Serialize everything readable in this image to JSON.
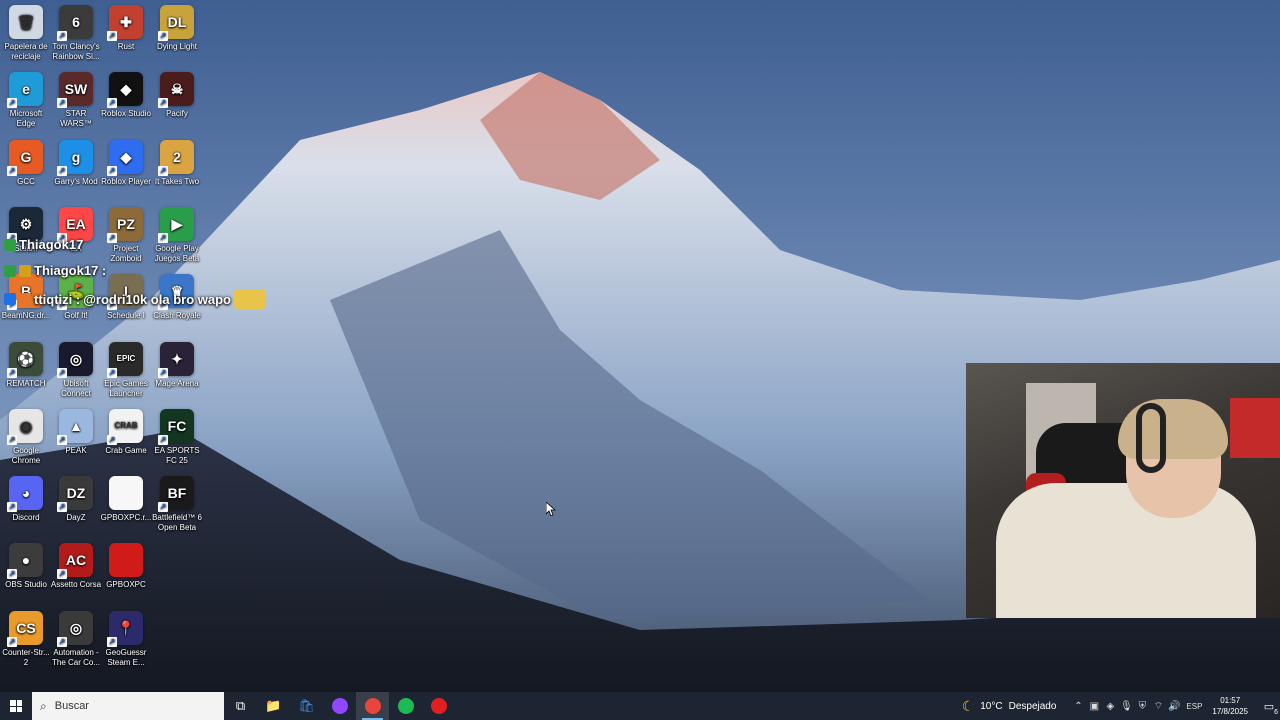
{
  "desktop": {
    "icons": [
      {
        "label": "Papelera de reciclaje",
        "icon": "recycle-bin-icon",
        "color": "#cfd8e3",
        "glyph": "🗑",
        "shortcut": false
      },
      {
        "label": "Tom Clancy's Rainbow Si...",
        "icon": "rainbow-six-icon",
        "color": "#3b3b3b",
        "glyph": "6",
        "shortcut": true
      },
      {
        "label": "Rust",
        "icon": "rust-icon",
        "color": "#c2402f",
        "glyph": "✚",
        "shortcut": true
      },
      {
        "label": "Dying Light",
        "icon": "dying-light-icon",
        "color": "#c8a23a",
        "glyph": "DL",
        "shortcut": true
      },
      {
        "label": "Microsoft Edge",
        "icon": "edge-icon",
        "color": "#1f9bd8",
        "glyph": "e",
        "shortcut": true
      },
      {
        "label": "STAR WARS™ Battlefront...",
        "icon": "star-wars-battlefront-icon",
        "color": "#5a2a2a",
        "glyph": "SW",
        "shortcut": true
      },
      {
        "label": "Roblox Studio",
        "icon": "roblox-studio-icon",
        "color": "#111111",
        "glyph": "◆",
        "shortcut": true
      },
      {
        "label": "Pacify",
        "icon": "pacify-icon",
        "color": "#4a1c1c",
        "glyph": "☠",
        "shortcut": true
      },
      {
        "label": "GCC",
        "icon": "gcc-icon",
        "color": "#e85a23",
        "glyph": "G",
        "shortcut": true
      },
      {
        "label": "Garry's Mod",
        "icon": "garrys-mod-icon",
        "color": "#1e8fe6",
        "glyph": "g",
        "shortcut": true
      },
      {
        "label": "Roblox Player",
        "icon": "roblox-player-icon",
        "color": "#2e6cf0",
        "glyph": "◆",
        "shortcut": true
      },
      {
        "label": "It Takes Two",
        "icon": "it-takes-two-icon",
        "color": "#d9a441",
        "glyph": "2",
        "shortcut": true
      },
      {
        "label": "Steam",
        "icon": "steam-icon",
        "color": "#1b2838",
        "glyph": "⚙",
        "shortcut": true
      },
      {
        "label": "EA",
        "icon": "ea-icon",
        "color": "#ff4747",
        "glyph": "EA",
        "shortcut": true
      },
      {
        "label": "Project Zomboid",
        "icon": "project-zomboid-icon",
        "color": "#8c6a3a",
        "glyph": "PZ",
        "shortcut": true
      },
      {
        "label": "Google Play Juegos Beta",
        "icon": "google-play-games-icon",
        "color": "#2a9d4a",
        "glyph": "▶",
        "shortcut": true
      },
      {
        "label": "BeamNG.dr...",
        "icon": "beamng-icon",
        "color": "#e8742a",
        "glyph": "B",
        "shortcut": true
      },
      {
        "label": "Golf It!",
        "icon": "golf-it-icon",
        "color": "#5db04a",
        "glyph": "⛳",
        "shortcut": true
      },
      {
        "label": "Schedule I",
        "icon": "schedule-one-icon",
        "color": "#7a6e52",
        "glyph": "I",
        "shortcut": true
      },
      {
        "label": "Clash Royale",
        "icon": "clash-royale-icon",
        "color": "#3b76c9",
        "glyph": "♛",
        "shortcut": true
      },
      {
        "label": "REMATCH",
        "icon": "rematch-icon",
        "color": "#3c4c3a",
        "glyph": "⚽",
        "shortcut": true
      },
      {
        "label": "Ubisoft Connect",
        "icon": "ubisoft-connect-icon",
        "color": "#1a1a2e",
        "glyph": "◎",
        "shortcut": true
      },
      {
        "label": "Epic Games Launcher",
        "icon": "epic-games-icon",
        "color": "#2a2a2a",
        "glyph": "EPIC",
        "shortcut": true
      },
      {
        "label": "Mage Arena",
        "icon": "mage-arena-icon",
        "color": "#2a2236",
        "glyph": "✦",
        "shortcut": true
      },
      {
        "label": "Google Chrome",
        "icon": "chrome-icon",
        "color": "#e6e6e6",
        "glyph": "◉",
        "shortcut": true
      },
      {
        "label": "PEAK",
        "icon": "peak-icon",
        "color": "#9ab7df",
        "glyph": "▲",
        "shortcut": true
      },
      {
        "label": "Crab Game",
        "icon": "crab-game-icon",
        "color": "#f2f2f2",
        "glyph": "CRAB",
        "shortcut": true
      },
      {
        "label": "EA SPORTS FC 25",
        "icon": "ea-sports-fc-icon",
        "color": "#12361f",
        "glyph": "FC",
        "shortcut": true
      },
      {
        "label": "Discord",
        "icon": "discord-icon",
        "color": "#5865f2",
        "glyph": "◕",
        "shortcut": true
      },
      {
        "label": "DayZ",
        "icon": "dayz-icon",
        "color": "#3a3a3a",
        "glyph": "DZ",
        "shortcut": true
      },
      {
        "label": "GPBOXPC.r...",
        "icon": "file-icon",
        "color": "#f7f7f7",
        "glyph": "",
        "shortcut": false
      },
      {
        "label": "Battlefield™ 6 Open Beta",
        "icon": "battlefield-icon",
        "color": "#1a1a1a",
        "glyph": "BF",
        "shortcut": true
      },
      {
        "label": "OBS Studio",
        "icon": "obs-icon",
        "color": "#3c3c3c",
        "glyph": "●",
        "shortcut": true
      },
      {
        "label": "Assetto Corsa",
        "icon": "assetto-corsa-icon",
        "color": "#b31b1b",
        "glyph": "AC",
        "shortcut": true
      },
      {
        "label": "GPBOXPC",
        "icon": "folder-icon",
        "color": "#d11a1a",
        "glyph": "",
        "shortcut": false
      },
      {
        "label": "",
        "icon": "empty",
        "color": "",
        "glyph": "",
        "shortcut": false
      },
      {
        "label": "Counter-Str... 2",
        "icon": "counter-strike-icon",
        "color": "#e89a2a",
        "glyph": "CS",
        "shortcut": true
      },
      {
        "label": "Automation - The Car Co...",
        "icon": "automation-icon",
        "color": "#3a3a3a",
        "glyph": "◎",
        "shortcut": true
      },
      {
        "label": "GeoGuessr Steam E...",
        "icon": "geoguessr-icon",
        "color": "#2c2a6b",
        "glyph": "📍",
        "shortcut": true
      }
    ]
  },
  "chat": {
    "lines": [
      {
        "user": "Thiagok17",
        "text": "",
        "badge_color": "#2ea043"
      },
      {
        "user": "Thiagok17 :",
        "text": "",
        "badge_color": "#d4a017"
      },
      {
        "user": "ttiqtizi :",
        "text": "@rodri10k ola bro wapo",
        "badge_color": "#1f6feb"
      }
    ]
  },
  "taskbar": {
    "search_placeholder": "Buscar",
    "apps": [
      {
        "name": "task-view-button",
        "glyph": "⧉",
        "color": "#ffffff",
        "active": false
      },
      {
        "name": "file-explorer-button",
        "glyph": "📁",
        "color": "#f0c24a",
        "active": false
      },
      {
        "name": "microsoft-store-button",
        "glyph": "🛍",
        "color": "#3a8ee6",
        "active": false
      },
      {
        "name": "twitch-chat-button",
        "glyph": "●",
        "color": "#9146ff",
        "active": false
      },
      {
        "name": "chrome-button",
        "glyph": "●",
        "color": "#e8453c",
        "active": true
      },
      {
        "name": "spotify-button",
        "glyph": "●",
        "color": "#1db954",
        "active": false
      },
      {
        "name": "game-launcher-button",
        "glyph": "●",
        "color": "#e02020",
        "active": false
      }
    ],
    "weather": {
      "temp": "10°C",
      "condition": "Despejado"
    },
    "language": "ESP",
    "time": "01:57",
    "date": "17/8/2025",
    "notifications": "6"
  }
}
